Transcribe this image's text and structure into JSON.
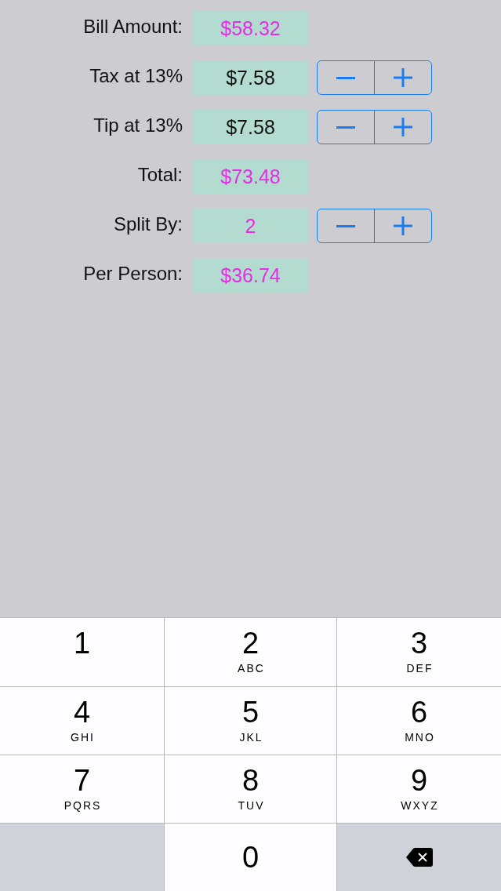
{
  "rows": [
    {
      "label": "Bill Amount:",
      "value": "$58.32",
      "color": "#e62ce6",
      "stepper": false
    },
    {
      "label": "Tax at 13%",
      "value": "$7.58",
      "color": "#111111",
      "stepper": true
    },
    {
      "label": "Tip at 13%",
      "value": "$7.58",
      "color": "#111111",
      "stepper": true
    },
    {
      "label": "Total:",
      "value": "$73.48",
      "color": "#e62ce6",
      "stepper": false
    },
    {
      "label": "Split By:",
      "value": "2",
      "color": "#e62ce6",
      "stepper": true
    },
    {
      "label": "Per Person:",
      "value": "$36.74",
      "color": "#e62ce6",
      "stepper": false
    }
  ],
  "keypad": {
    "keys": [
      {
        "kind": "digit",
        "digit": "1"
      },
      {
        "kind": "digit",
        "digit": "2",
        "letters": "ABC"
      },
      {
        "kind": "digit",
        "digit": "3",
        "letters": "DEF"
      },
      {
        "kind": "digit",
        "digit": "4",
        "letters": "GHI"
      },
      {
        "kind": "digit",
        "digit": "5",
        "letters": "JKL"
      },
      {
        "kind": "digit",
        "digit": "6",
        "letters": "MNO"
      },
      {
        "kind": "digit",
        "digit": "7",
        "letters": "PQRS"
      },
      {
        "kind": "digit",
        "digit": "8",
        "letters": "TUV"
      },
      {
        "kind": "digit",
        "digit": "9",
        "letters": "WXYZ"
      },
      {
        "kind": "blank"
      },
      {
        "kind": "digit",
        "digit": "0"
      },
      {
        "kind": "delete"
      }
    ]
  }
}
